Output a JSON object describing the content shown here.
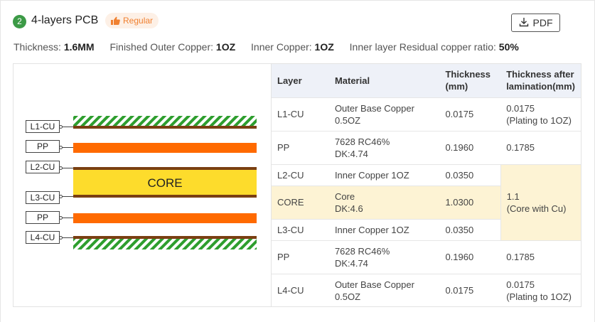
{
  "header": {
    "step_number": "2",
    "title": "4-layers PCB",
    "badge_label": "Regular",
    "pdf_label": "PDF"
  },
  "specs": [
    {
      "key": "Thickness:",
      "value": "1.6MM"
    },
    {
      "key": "Finished Outer Copper:",
      "value": "1OZ"
    },
    {
      "key": "Inner Copper:",
      "value": "1OZ"
    },
    {
      "key": "Inner layer Residual copper ratio:",
      "value": "50%"
    }
  ],
  "diagram": {
    "labels": [
      "L1-CU",
      "PP",
      "L2-CU",
      "L3-CU",
      "PP",
      "L4-CU"
    ],
    "core_label": "CORE"
  },
  "table": {
    "headers": [
      "Layer",
      "Material",
      "Thickness (mm)",
      "Thickness after lamination(mm)"
    ],
    "rows": [
      {
        "layer": "L1-CU",
        "material_1": "Outer Base Copper",
        "material_2": "0.5OZ",
        "thickness": "0.0175",
        "lam_1": "0.0175",
        "lam_2": "(Plating to 1OZ)"
      },
      {
        "layer": "PP",
        "material_1": "7628 RC46%",
        "material_2": "DK:4.74",
        "thickness": "0.1960",
        "lam_1": "0.1785",
        "lam_2": ""
      },
      {
        "layer": "L2-CU",
        "material_1": "Inner Copper 1OZ",
        "material_2": "",
        "thickness": "0.0350",
        "lam_1": "",
        "lam_2": ""
      },
      {
        "layer": "CORE",
        "material_1": "Core",
        "material_2": "DK:4.6",
        "thickness": "1.0300",
        "lam_1": "",
        "lam_2": ""
      },
      {
        "layer": "L3-CU",
        "material_1": "Inner Copper 1OZ",
        "material_2": "",
        "thickness": "0.0350",
        "lam_1": "",
        "lam_2": ""
      },
      {
        "layer": "PP",
        "material_1": "7628 RC46%",
        "material_2": "DK:4.74",
        "thickness": "0.1960",
        "lam_1": "0.1785",
        "lam_2": ""
      },
      {
        "layer": "L4-CU",
        "material_1": "Outer Base Copper",
        "material_2": "0.5OZ",
        "thickness": "0.0175",
        "lam_1": "0.0175",
        "lam_2": "(Plating to 1OZ)"
      }
    ],
    "merged_lamination_1": "1.1",
    "merged_lamination_2": "(Core with Cu)"
  },
  "colors": {
    "step_green": "#3c9a46",
    "badge_orange": "#f08030",
    "copper_brown": "#7a3f12",
    "prepreg_orange": "#ff6a00",
    "core_yellow": "#fddc2c",
    "hatch_green": "#2e9e2e",
    "highlight_cream": "#fdf3d4",
    "table_header_bg": "#eef1f8"
  },
  "icons": [
    "thumbs-up-icon",
    "download-icon"
  ]
}
